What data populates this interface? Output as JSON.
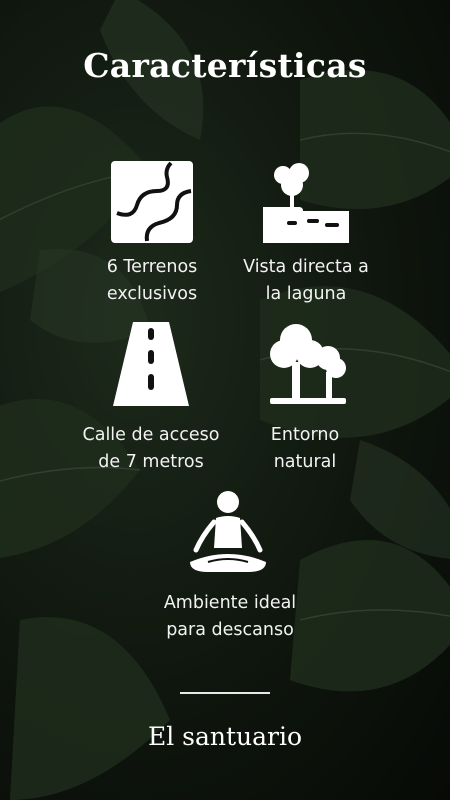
{
  "title": "Características",
  "features": [
    {
      "icon": "map-icon",
      "label": "6 Terrenos\nexclusivos"
    },
    {
      "icon": "lagoon-view-icon",
      "label": "Vista directa a\nla laguna"
    },
    {
      "icon": "road-icon",
      "label": "Calle de acceso\nde 7 metros"
    },
    {
      "icon": "trees-icon",
      "label": "Entorno\nnatural"
    },
    {
      "icon": "meditation-icon",
      "label": "Ambiente ideal\npara descanso"
    }
  ],
  "brand": "El santuario",
  "colors": {
    "foreground": "#ffffff",
    "background": "#0f160e"
  }
}
